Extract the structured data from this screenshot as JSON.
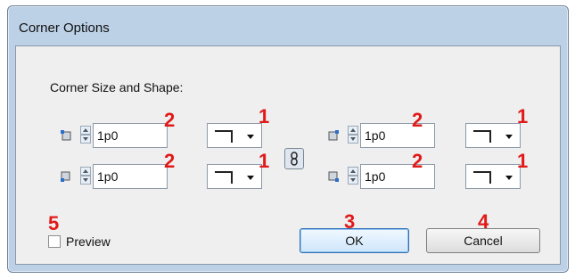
{
  "window": {
    "title": "Corner Options"
  },
  "section": {
    "heading": "Corner Size and Shape:"
  },
  "corners": [
    {
      "name": "top-left",
      "size": "1p0"
    },
    {
      "name": "top-right",
      "size": "1p0"
    },
    {
      "name": "bottom-left",
      "size": "1p0"
    },
    {
      "name": "bottom-right",
      "size": "1p0"
    }
  ],
  "annotations": {
    "shape": "1",
    "size": "2",
    "ok": "3",
    "cancel": "4",
    "preview": "5"
  },
  "preview": {
    "label": "Preview",
    "checked": false
  },
  "buttons": {
    "ok": "OK",
    "cancel": "Cancel"
  },
  "colors": {
    "annotation": "#e11919",
    "dialog_border": "#bcd0e6",
    "accent": "#2f6fb0"
  },
  "icons": [
    "corner-top-left-icon",
    "corner-top-right-icon",
    "corner-bottom-left-icon",
    "corner-bottom-right-icon",
    "link-chain-icon",
    "chevron-down-icon"
  ]
}
